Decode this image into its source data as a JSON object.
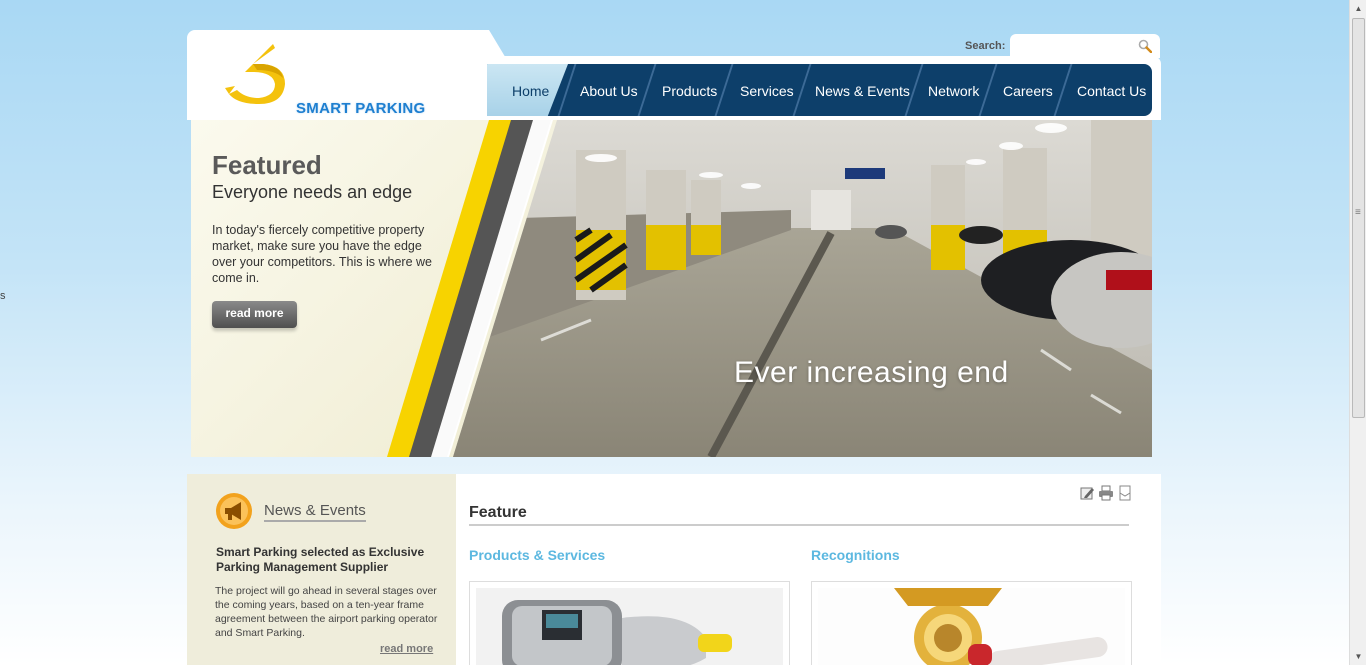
{
  "stray_text": "s",
  "logo": {
    "text": "SMART PARKING"
  },
  "search": {
    "label": "Search:",
    "value": "",
    "placeholder": ""
  },
  "nav": {
    "items": [
      {
        "label": "Home",
        "active": true
      },
      {
        "label": "About Us"
      },
      {
        "label": "Products"
      },
      {
        "label": "Services"
      },
      {
        "label": "News & Events"
      },
      {
        "label": "Network"
      },
      {
        "label": "Careers"
      },
      {
        "label": "Contact Us"
      }
    ]
  },
  "hero": {
    "title": "Featured",
    "subtitle": "Everyone needs an edge",
    "body": "In today's fiercely competitive property market, make sure you have the edge over your competitors. This is where we come in.",
    "button": "read more",
    "caption": "Ever increasing end"
  },
  "news": {
    "heading": "News & Events",
    "item_title": "Smart Parking selected as Exclusive Parking Management Supplier",
    "item_body": "The project will go ahead in several stages over the coming years, based on a ten-year frame agreement between the airport parking operator and Smart Parking.",
    "read_more": "read more"
  },
  "content": {
    "heading": "Feature",
    "col1": "Products & Services",
    "col2": "Recognitions"
  },
  "colors": {
    "nav_bg": "#0d3f6a",
    "accent_blue": "#5cb8e0",
    "logo_yellow": "#f4c20d",
    "stripe_yellow": "#f7d300"
  }
}
